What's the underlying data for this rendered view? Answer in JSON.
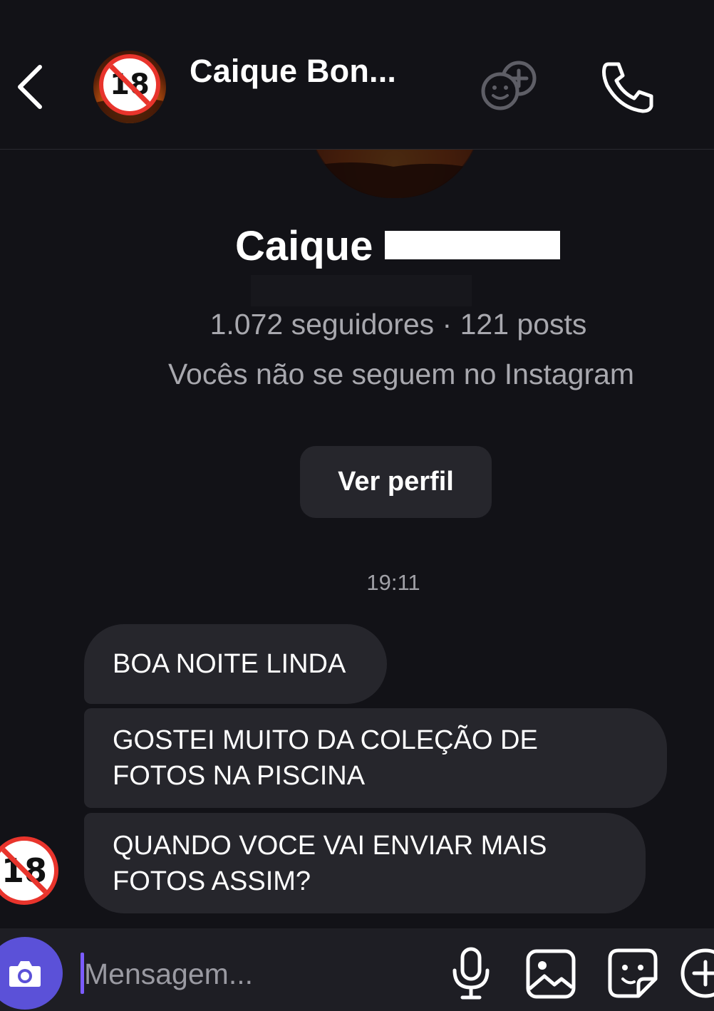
{
  "header": {
    "contact_name": "Caique Bon...",
    "avatar_badge": "18"
  },
  "profile": {
    "name": "Caique",
    "stats": "1.072 seguidores · 121 posts",
    "relationship": "Vocês não se seguem no Instagram",
    "view_profile_label": "Ver perfil"
  },
  "conversation": {
    "timestamp": "19:11",
    "messages": [
      {
        "text": "BOA NOITE LINDA"
      },
      {
        "text": "GOSTEI MUITO DA COLEÇÃO DE FOTOS NA PISCINA"
      },
      {
        "text": "QUANDO VOCE VAI ENVIAR MAIS FOTOS ASSIM?"
      }
    ],
    "sender_badge": "18"
  },
  "composer": {
    "placeholder": "Mensagem..."
  },
  "icons": {
    "back": "back-chevron-icon",
    "group": "add-people-icon",
    "call": "phone-icon",
    "camera": "camera-icon",
    "mic": "microphone-icon",
    "gallery": "image-icon",
    "sticker": "sticker-icon",
    "plus": "plus-icon"
  },
  "colors": {
    "background": "#121217",
    "bubble": "#26262c",
    "secondary_text": "#a8a8ae",
    "camera_accent": "#5b51d8",
    "badge_red": "#e8342c"
  }
}
